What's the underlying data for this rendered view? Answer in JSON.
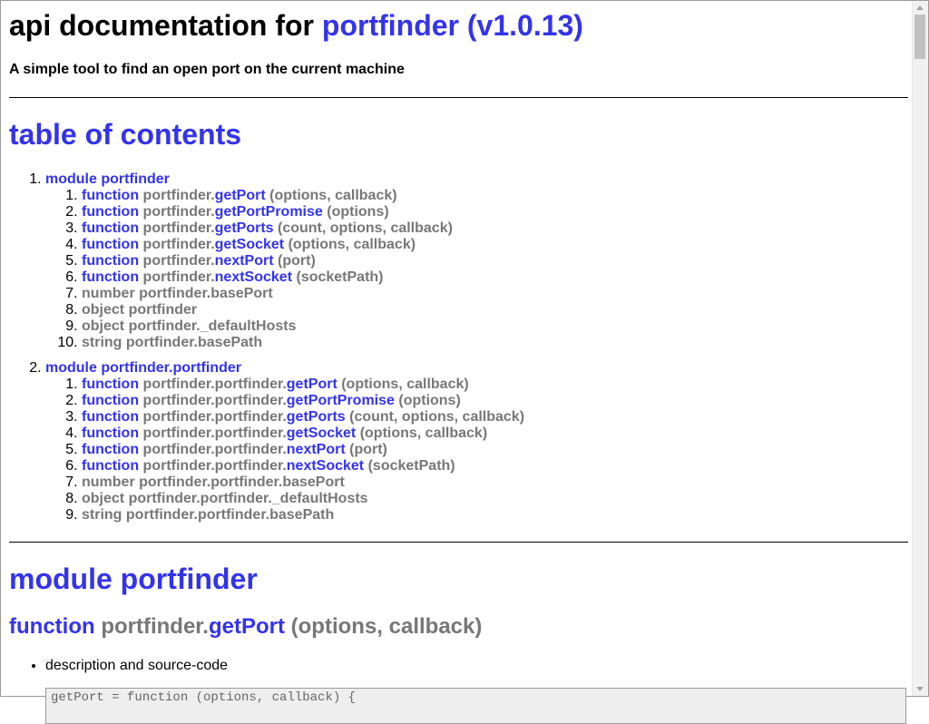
{
  "header": {
    "title_prefix": "api documentation for",
    "title_link": "portfinder (v1.0.13)",
    "tagline": "A simple tool to find an open port on the current machine"
  },
  "toc": {
    "heading": "table of contents",
    "modules": [
      {
        "label": "module portfinder",
        "items": [
          {
            "kind": "function",
            "prefix": "portfinder.",
            "name": "getPort",
            "args": "(options, callback)"
          },
          {
            "kind": "function",
            "prefix": "portfinder.",
            "name": "getPortPromise",
            "args": "(options)"
          },
          {
            "kind": "function",
            "prefix": "portfinder.",
            "name": "getPorts",
            "args": "(count, options, callback)"
          },
          {
            "kind": "function",
            "prefix": "portfinder.",
            "name": "getSocket",
            "args": "(options, callback)"
          },
          {
            "kind": "function",
            "prefix": "portfinder.",
            "name": "nextPort",
            "args": "(port)"
          },
          {
            "kind": "function",
            "prefix": "portfinder.",
            "name": "nextSocket",
            "args": "(socketPath)"
          },
          {
            "kind": "number",
            "text": "number portfinder.basePort"
          },
          {
            "kind": "object",
            "text": "object portfinder"
          },
          {
            "kind": "object",
            "text": "object portfinder._defaultHosts"
          },
          {
            "kind": "string",
            "text": "string portfinder.basePath"
          }
        ]
      },
      {
        "label": "module portfinder.portfinder",
        "items": [
          {
            "kind": "function",
            "prefix": "portfinder.portfinder.",
            "name": "getPort",
            "args": "(options, callback)"
          },
          {
            "kind": "function",
            "prefix": "portfinder.portfinder.",
            "name": "getPortPromise",
            "args": "(options)"
          },
          {
            "kind": "function",
            "prefix": "portfinder.portfinder.",
            "name": "getPorts",
            "args": "(count, options, callback)"
          },
          {
            "kind": "function",
            "prefix": "portfinder.portfinder.",
            "name": "getSocket",
            "args": "(options, callback)"
          },
          {
            "kind": "function",
            "prefix": "portfinder.portfinder.",
            "name": "nextPort",
            "args": "(port)"
          },
          {
            "kind": "function",
            "prefix": "portfinder.portfinder.",
            "name": "nextSocket",
            "args": "(socketPath)"
          },
          {
            "kind": "number",
            "text": "number portfinder.portfinder.basePort"
          },
          {
            "kind": "object",
            "text": "object portfinder.portfinder._defaultHosts"
          },
          {
            "kind": "string",
            "text": "string portfinder.portfinder.basePath"
          }
        ]
      }
    ]
  },
  "section": {
    "module_heading": "module portfinder",
    "function_keyword": "function",
    "function_prefix": "portfinder.",
    "function_name": "getPort",
    "function_args": "(options, callback)",
    "bullet": "description and source-code",
    "code_snippet": "getPort = function (options, callback) {"
  },
  "colors": {
    "link": "#3333ee",
    "muted": "#777777",
    "code_bg": "#eeeeee"
  }
}
